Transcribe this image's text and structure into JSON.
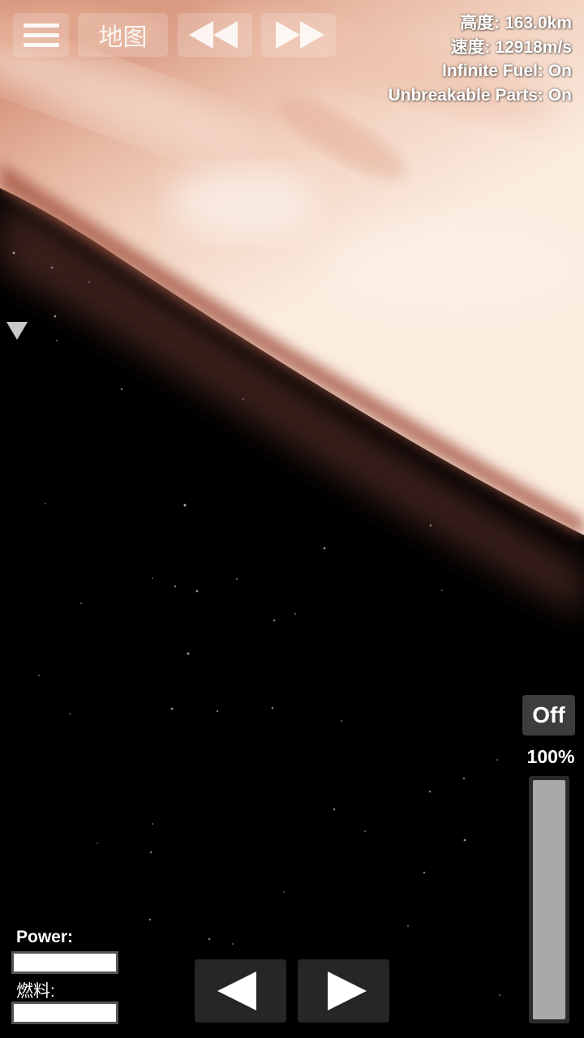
{
  "hud": {
    "map_label": "地图",
    "icons": {
      "menu": "hamburger-menu-icon",
      "rewind": "rewind-icon",
      "fast_forward": "fast-forward-icon",
      "rotate_left": "triangle-left-icon",
      "rotate_right": "triangle-right-icon",
      "marker": "triangle-down-icon"
    }
  },
  "stats": {
    "altitude": "高度: 163.0km",
    "speed": "速度: 12918m/s",
    "infinite_fuel": "Infinite Fuel: On",
    "unbreakable_parts": "Unbreakable Parts: On"
  },
  "throttle": {
    "toggle_label": "Off",
    "percent_label": "100%",
    "level": 1.0
  },
  "resources": {
    "power_label": "Power:",
    "power_level": 1.0,
    "fuel_label": "燃料:",
    "fuel_level": 1.0
  },
  "colors": {
    "planet_light": "#f8e6d8",
    "planet_mid": "#e2aa90",
    "planet_dark": "#b06a55",
    "space": "#000000"
  }
}
